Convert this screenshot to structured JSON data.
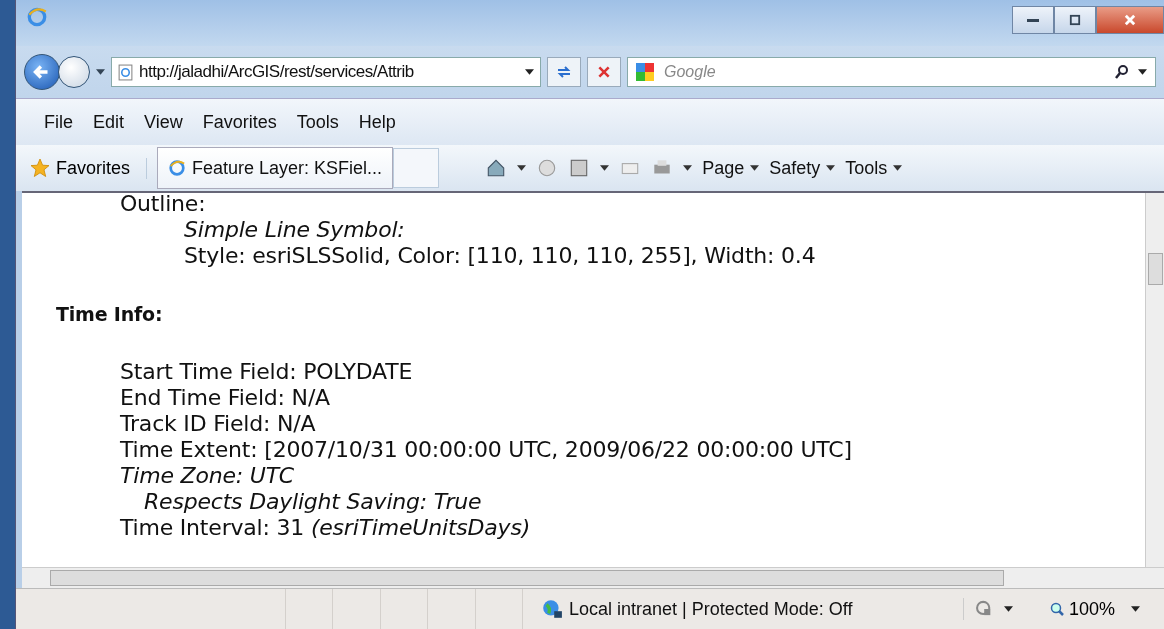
{
  "address_bar": {
    "url": "http://jaladhi/ArcGIS/rest/services/Attrib"
  },
  "search": {
    "placeholder": "Google"
  },
  "menu": [
    "File",
    "Edit",
    "View",
    "Favorites",
    "Tools",
    "Help"
  ],
  "favorites": {
    "label": "Favorites"
  },
  "tab": {
    "title": "Feature Layer: KSFiel...",
    "selected": true
  },
  "command_bar": [
    "Page",
    "Safety",
    "Tools"
  ],
  "content": [
    {
      "kind": "value",
      "text": "Outline:",
      "children": [
        {
          "kind": "label",
          "text": "Simple Line Symbol:"
        },
        {
          "kind": "value",
          "text": "Style: esriSLSSolid, Color: [110, 110, 110, 255], Width: 0.4"
        }
      ]
    },
    {
      "kind": "heading",
      "text": "Time Info:",
      "children": [
        {
          "kind": "value",
          "text": "Start Time Field: POLYDATE"
        },
        {
          "kind": "value",
          "text": "End Time Field: N/A"
        },
        {
          "kind": "value",
          "text": "Track ID Field: N/A"
        },
        {
          "kind": "value",
          "text": "Time Extent: [2007/10/31 00:00:00 UTC, 2009/06/22 00:00:00 UTC]"
        },
        {
          "kind": "label",
          "text": "Time Zone: UTC",
          "children": [
            {
              "kind": "label",
              "text": "Respects Daylight Saving: True"
            }
          ]
        },
        {
          "kind": "value",
          "text": "Time Interval: 31 *(esriTimeUnitsDays)*"
        }
      ]
    }
  ],
  "status_bar": {
    "zone": "Local intranet | Protected Mode: Off",
    "zoom": "100%"
  }
}
